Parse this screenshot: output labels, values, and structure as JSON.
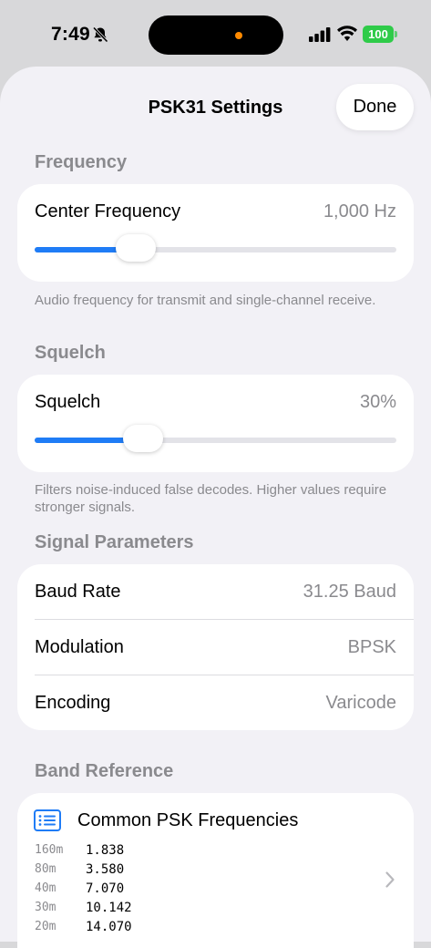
{
  "status_bar": {
    "time": "7:49",
    "battery": "100",
    "colors": {
      "battery": "#2fcb49",
      "island_dot": "#ff8a00"
    }
  },
  "nav": {
    "title": "PSK31 Settings",
    "done_label": "Done"
  },
  "frequency": {
    "header": "Frequency",
    "label": "Center Frequency",
    "value": "1,000 Hz",
    "slider_fraction": 0.28,
    "footnote": "Audio frequency for transmit and single-channel receive."
  },
  "squelch": {
    "header": "Squelch",
    "label": "Squelch",
    "value": "30%",
    "slider_fraction": 0.3,
    "footnote": "Filters noise-induced false decodes. Higher values require stronger signals."
  },
  "signal": {
    "header": "Signal Parameters",
    "rows": [
      {
        "label": "Baud Rate",
        "value": "31.25 Baud"
      },
      {
        "label": "Modulation",
        "value": "BPSK"
      },
      {
        "label": "Encoding",
        "value": "Varicode"
      }
    ]
  },
  "band_reference": {
    "header": "Band Reference",
    "title": "Common PSK Frequencies",
    "bands": [
      {
        "band": "160m",
        "freq": "1.838"
      },
      {
        "band": "80m",
        "freq": "3.580"
      },
      {
        "band": "40m",
        "freq": "7.070"
      },
      {
        "band": "30m",
        "freq": "10.142"
      },
      {
        "band": "20m",
        "freq": "14.070"
      }
    ]
  },
  "colors": {
    "accent": "#1f7cf6",
    "secondary_text": "#8a8a8e",
    "background": "#f2f1f6"
  }
}
